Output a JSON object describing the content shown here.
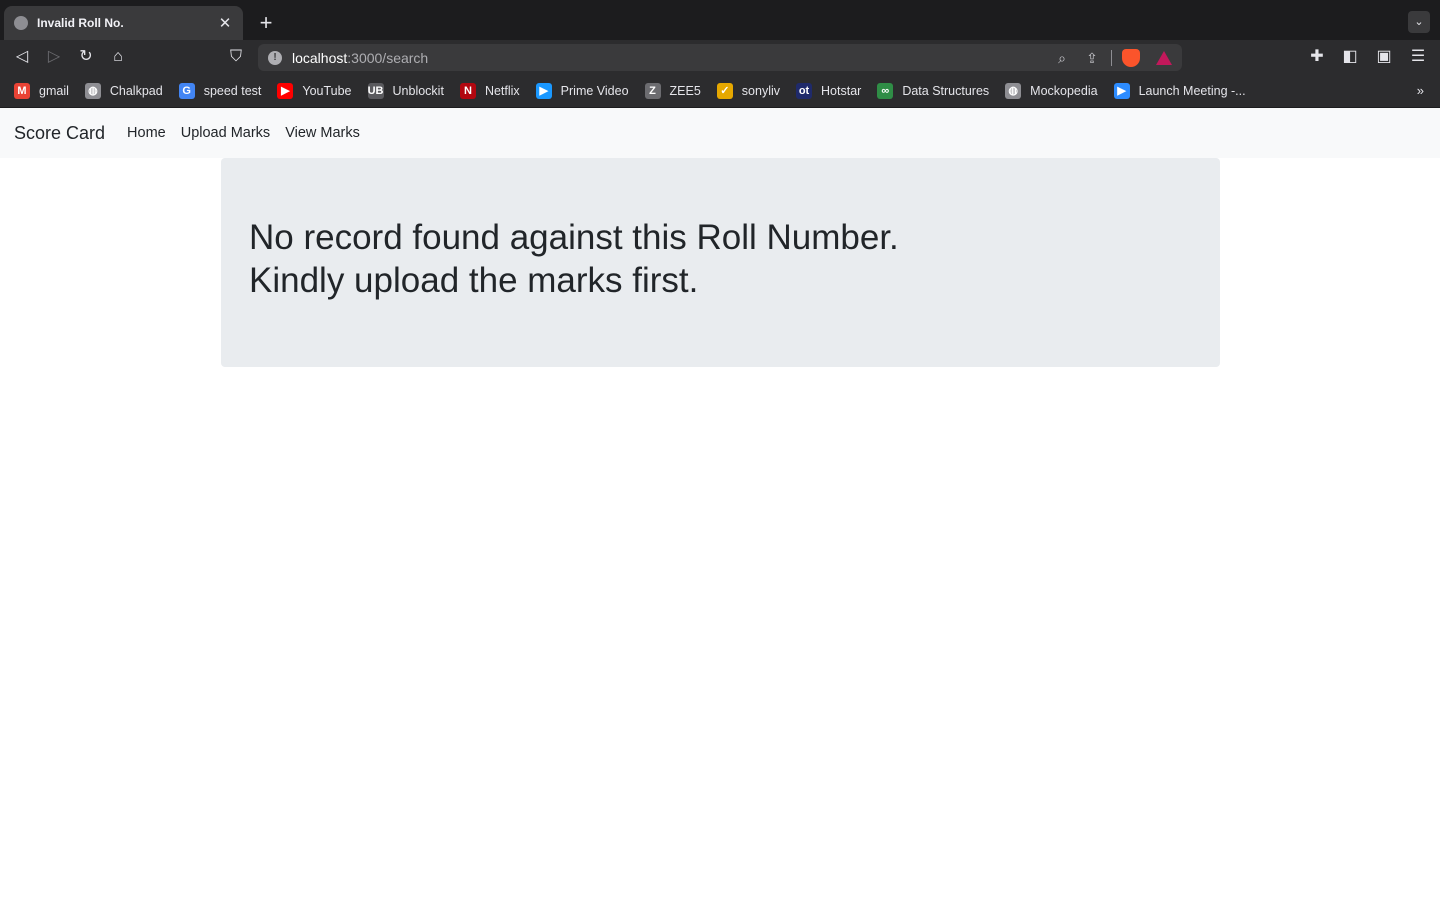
{
  "browser": {
    "tab": {
      "title": "Invalid Roll No.",
      "close": "✕"
    },
    "new_tab": "+",
    "tab_menu": "⌄",
    "nav": {
      "back": "◁",
      "forward": "▷",
      "reload": "↻",
      "home": "⌂",
      "bookmark": "⛉"
    },
    "address": {
      "host": "localhost",
      "path": ":3000/search"
    },
    "omni_icons": {
      "zoom": "⌕",
      "share": "⇪"
    },
    "right_icons": {
      "extensions": "✚",
      "sidebar": "◧",
      "wallet": "▣",
      "menu": "☰"
    },
    "bookmarks": [
      {
        "label": "gmail",
        "icon": "M",
        "color": "#ea4335"
      },
      {
        "label": "Chalkpad",
        "icon": "◍",
        "color": "#8e8e93"
      },
      {
        "label": "speed test",
        "icon": "G",
        "color": "#4285f4"
      },
      {
        "label": "YouTube",
        "icon": "▶",
        "color": "#ff0000"
      },
      {
        "label": "Unblockit",
        "icon": "UB",
        "color": "#5a5a5e"
      },
      {
        "label": "Netflix",
        "icon": "N",
        "color": "#b20710"
      },
      {
        "label": "Prime Video",
        "icon": "▶",
        "color": "#1a98ff"
      },
      {
        "label": "ZEE5",
        "icon": "Z",
        "color": "#6c6c70"
      },
      {
        "label": "sonyliv",
        "icon": "✓",
        "color": "#e6a800"
      },
      {
        "label": "Hotstar",
        "icon": "ot",
        "color": "#1f2a6b"
      },
      {
        "label": "Data Structures",
        "icon": "∞",
        "color": "#2f8d46"
      },
      {
        "label": "Mockopedia",
        "icon": "◍",
        "color": "#8e8e93"
      },
      {
        "label": "Launch Meeting -...",
        "icon": "▶",
        "color": "#2d8cff"
      }
    ],
    "bookmarks_more": "»"
  },
  "navbar": {
    "brand": "Score Card",
    "links": [
      "Home",
      "Upload Marks",
      "View Marks"
    ]
  },
  "message": {
    "line1": "No record found against this Roll Number.",
    "line2": "Kindly upload the marks first."
  }
}
